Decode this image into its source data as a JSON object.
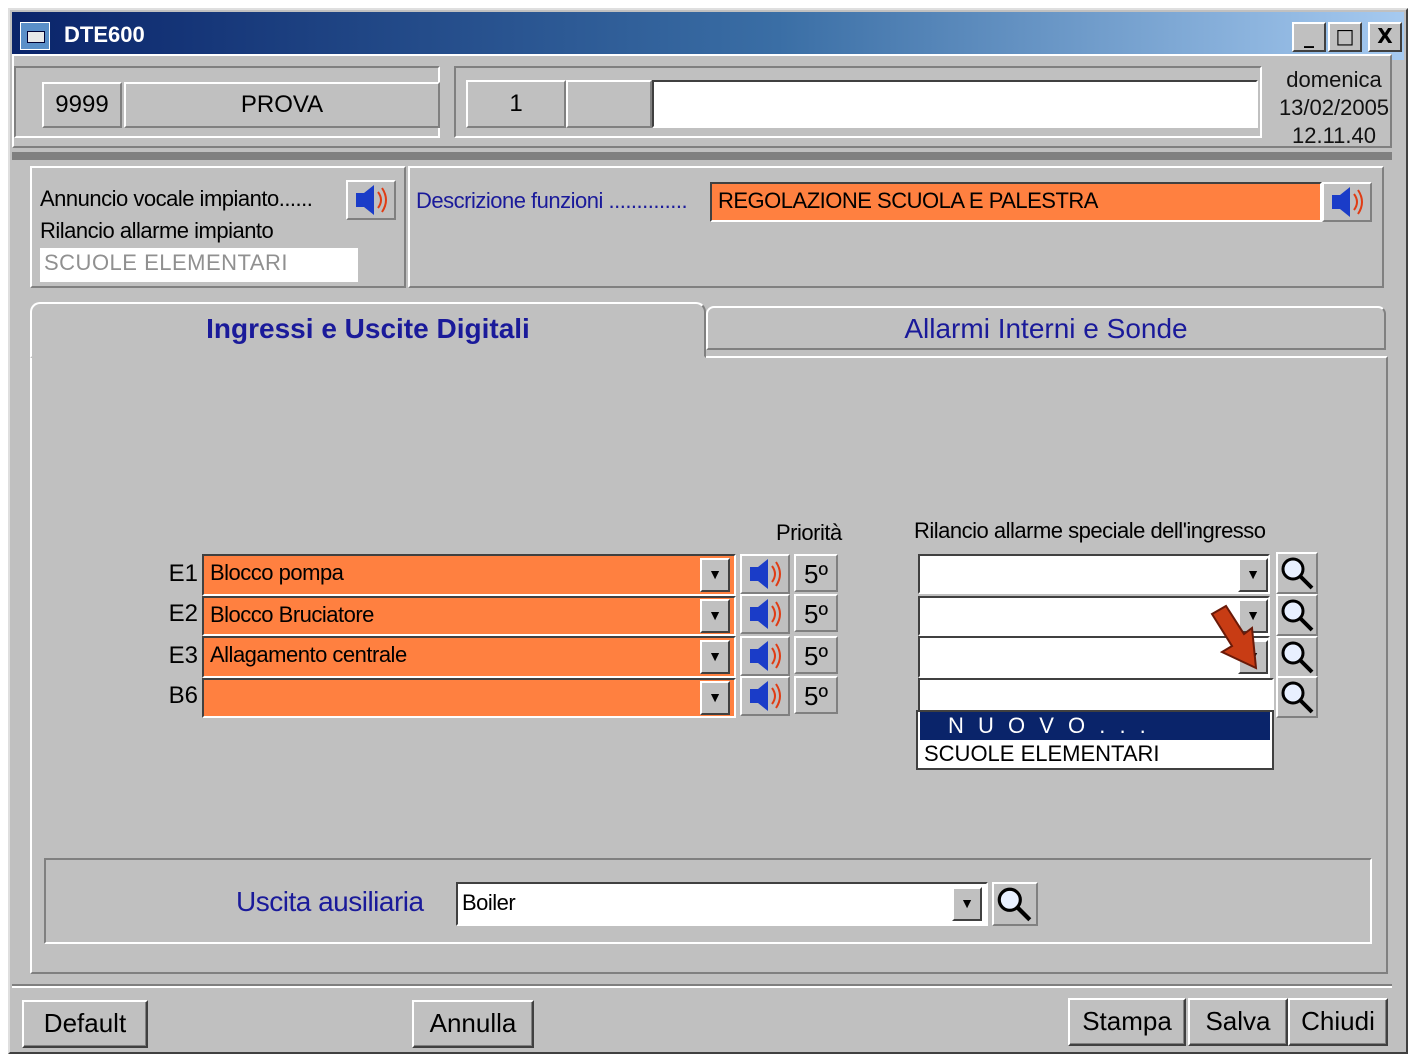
{
  "window": {
    "title": "DTE600",
    "controls": {
      "minimize": "_",
      "maximize": "□",
      "close": "X"
    }
  },
  "header": {
    "code": "9999",
    "name": "PROVA",
    "number": "1",
    "blank_cell": "",
    "description": "",
    "day": "domenica",
    "date": "13/02/2005",
    "time": "12.11.40"
  },
  "info": {
    "voice_label": "Annuncio vocale impianto......",
    "alarm_label": "Rilancio allarme impianto",
    "alarm_value": "SCUOLE ELEMENTARI"
  },
  "functions": {
    "label": "Descrizione funzioni ..............",
    "value": "REGOLAZIONE SCUOLA E PALESTRA"
  },
  "tabs": [
    {
      "label": "Ingressi e Uscite Digitali",
      "active": true
    },
    {
      "label": "Allarmi Interni e Sonde",
      "active": false
    }
  ],
  "inputs": {
    "priority_header": "Priorità",
    "special_header": "Rilancio allarme speciale dell'ingresso",
    "rows": [
      {
        "id": "E1",
        "value": "Blocco pompa",
        "priority": "5º",
        "special": ""
      },
      {
        "id": "E2",
        "value": "Blocco Bruciatore",
        "priority": "5º",
        "special": ""
      },
      {
        "id": "E3",
        "value": "Allagamento centrale",
        "priority": "5º",
        "special": ""
      },
      {
        "id": "B6",
        "value": "",
        "priority": "5º",
        "special": ""
      }
    ]
  },
  "dropdown": {
    "options": [
      "N U O V O . . .",
      "SCUOLE ELEMENTARI"
    ],
    "highlighted": "N U O V O . . ."
  },
  "auxiliary": {
    "label": "Uscita ausiliaria",
    "value": "Boiler"
  },
  "buttons": {
    "default": "Default",
    "cancel": "Annulla",
    "print": "Stampa",
    "save": "Salva",
    "close": "Chiudi"
  },
  "colors": {
    "accent_field": "#ff8040",
    "title_bar": "#0a246a",
    "label_text": "#1a1a9a",
    "arrow": "#c83c14"
  },
  "icons": [
    "speaker-icon",
    "magnifier-icon",
    "dropdown-arrow-icon",
    "pointer-arrow-icon",
    "app-icon"
  ]
}
